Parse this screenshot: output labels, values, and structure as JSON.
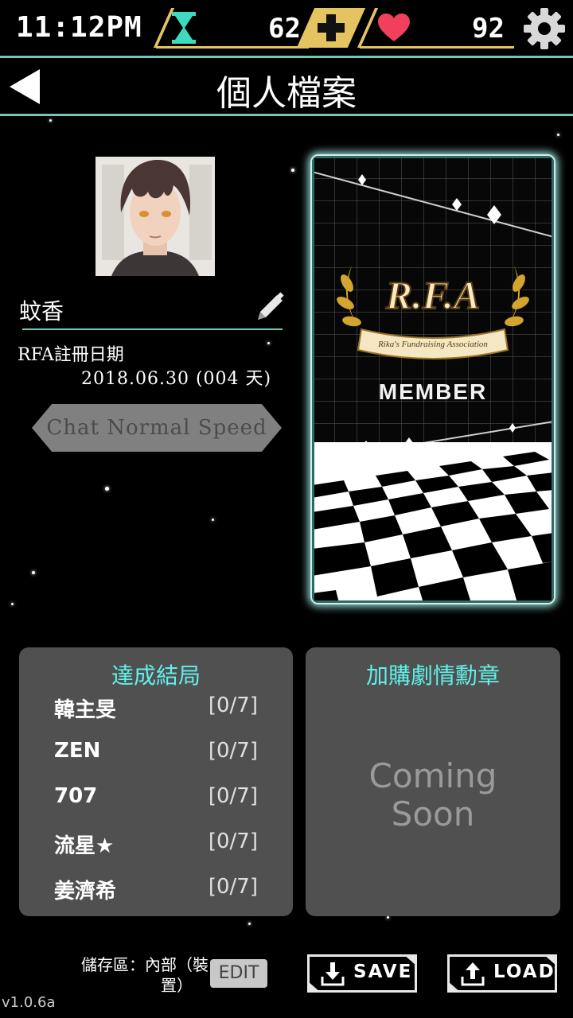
{
  "status": {
    "time": "11:12PM",
    "hourglass_count": "62",
    "heart_count": "92"
  },
  "header": {
    "title": "個人檔案"
  },
  "profile": {
    "username": "蚊香",
    "reg_label": "RFA註冊日期",
    "reg_date": "2018.06.30 (004 天)",
    "chat_speed": "Chat Normal Speed"
  },
  "card": {
    "logo": "R.F.A",
    "banner": "Rika's Fundraising Association",
    "label": "MEMBER"
  },
  "endings": {
    "title": "達成結局",
    "rows": [
      {
        "name": "韓主旻",
        "count": "[0/7]"
      },
      {
        "name": "ZEN",
        "count": "[0/7]"
      },
      {
        "name": "707",
        "count": "[0/7]"
      },
      {
        "name": "流星★",
        "count": "[0/7]"
      },
      {
        "name": "姜濟希",
        "count": "[0/7]"
      }
    ]
  },
  "badges": {
    "title": "加購劇情勳章",
    "line1": "Coming",
    "line2": "Soon"
  },
  "footer": {
    "storage_line1": "儲存區：內部（裝",
    "storage_line2": "置）",
    "edit_label": "EDIT",
    "save_label": "SAVE",
    "load_label": "LOAD",
    "version": "v1.0.6a"
  },
  "colors": {
    "accent": "#6fc9b8",
    "gold": "#e4c460",
    "heart": "#f0405e",
    "cyan_text": "#5ff2ea",
    "panel": "#505050"
  },
  "icons": [
    "hourglass-icon",
    "plus-icon",
    "heart-icon",
    "gear-icon",
    "back-arrow-icon",
    "pencil-icon",
    "save-icon",
    "load-icon"
  ]
}
